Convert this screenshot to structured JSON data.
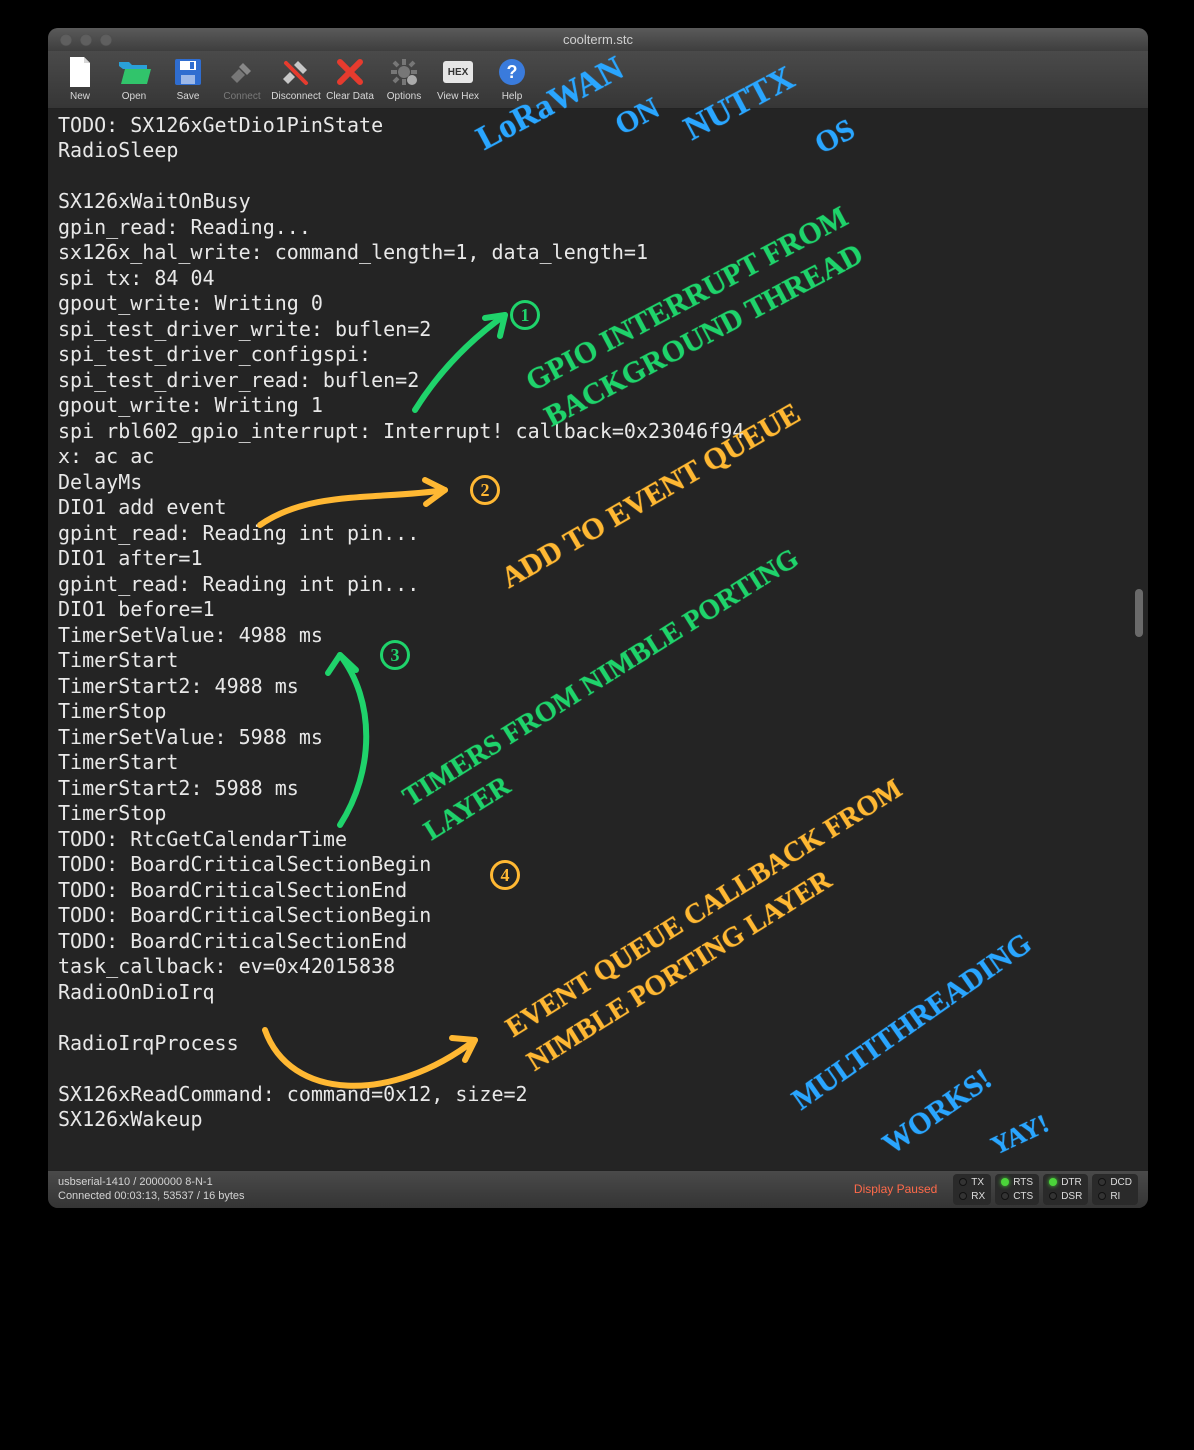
{
  "window": {
    "title": "coolterm.stc"
  },
  "toolbar": {
    "new": "New",
    "open": "Open",
    "save": "Save",
    "connect": "Connect",
    "disconnect": "Disconnect",
    "clear": "Clear Data",
    "options": "Options",
    "viewhex": "View Hex",
    "help": "Help"
  },
  "terminal": {
    "lines": [
      "TODO: SX126xGetDio1PinState",
      "RadioSleep",
      "",
      "SX126xWaitOnBusy",
      "gpin_read: Reading...",
      "sx126x_hal_write: command_length=1, data_length=1",
      "spi tx: 84 04",
      "gpout_write: Writing 0",
      "spi_test_driver_write: buflen=2",
      "spi_test_driver_configspi:",
      "spi_test_driver_read: buflen=2",
      "gpout_write: Writing 1",
      "spi rbl602_gpio_interrupt: Interrupt! callback=0x23046f94",
      "x: ac ac",
      "DelayMs",
      "DIO1 add event",
      "gpint_read: Reading int pin...",
      "DIO1 after=1",
      "gpint_read: Reading int pin...",
      "DIO1 before=1",
      "TimerSetValue: 4988 ms",
      "TimerStart",
      "TimerStart2: 4988 ms",
      "TimerStop",
      "TimerSetValue: 5988 ms",
      "TimerStart",
      "TimerStart2: 5988 ms",
      "TimerStop",
      "TODO: RtcGetCalendarTime",
      "TODO: BoardCriticalSectionBegin",
      "TODO: BoardCriticalSectionEnd",
      "TODO: BoardCriticalSectionBegin",
      "TODO: BoardCriticalSectionEnd",
      "task_callback: ev=0x42015838",
      "RadioOnDioIrq",
      "",
      "RadioIrqProcess",
      "",
      "SX126xReadCommand: command=0x12, size=2",
      "SX126xWakeup"
    ]
  },
  "status": {
    "line1": "usbserial-1410 / 2000000 8-N-1",
    "line2": "Connected 00:03:13, 53537 / 16 bytes",
    "paused": "Display Paused",
    "tx": "TX",
    "rx": "RX",
    "rts": "RTS",
    "cts": "CTS",
    "dtr": "DTR",
    "dsr": "DSR",
    "dcd": "DCD",
    "ri": "RI"
  },
  "annotations": {
    "title1": "LoRaWAN",
    "title2": "ON",
    "title3": "NUTTX",
    "title4": "OS",
    "n1": "1",
    "n1_text": "GPIO INTERRUPT FROM BACKGROUND THREAD",
    "n2": "2",
    "n2_text": "ADD TO EVENT QUEUE",
    "n3": "3",
    "n3_text": "TIMERS FROM NIMBLE PORTING LAYER",
    "n4": "4",
    "n4_text": "EVENT QUEUE CALLBACK FROM NIMBLE PORTING LAYER",
    "foot1": "MULTITHREADING",
    "foot2": "WORKS!",
    "foot3": "YAY!"
  }
}
